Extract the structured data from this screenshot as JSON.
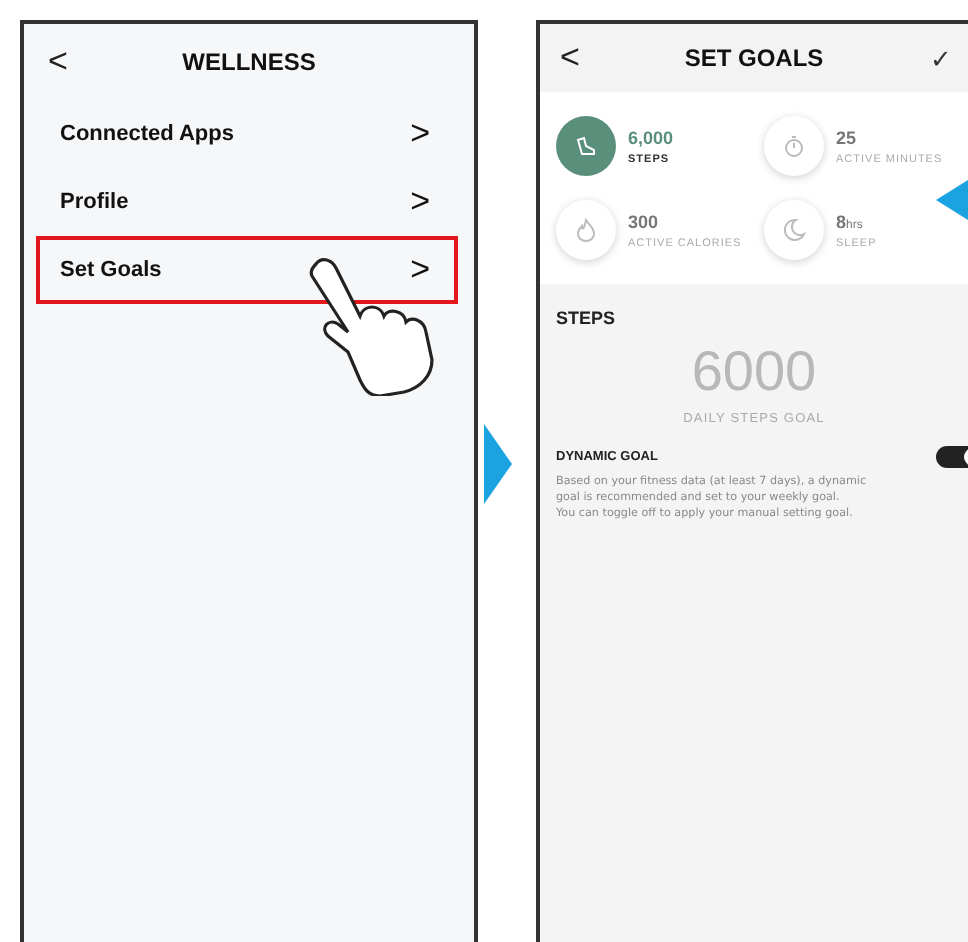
{
  "left_screen": {
    "back": "<",
    "title": "WELLNESS",
    "items": [
      {
        "label": "Connected Apps",
        "chevron": ">",
        "selected": false
      },
      {
        "label": "Profile",
        "chevron": ">",
        "selected": false
      },
      {
        "label": "Set Goals",
        "chevron": ">",
        "selected": true
      }
    ]
  },
  "right_screen": {
    "back": "<",
    "title": "SET GOALS",
    "confirm": "✓",
    "goals": [
      {
        "kind": "steps",
        "value": "6,000",
        "label": "STEPS",
        "selected": true
      },
      {
        "kind": "minutes",
        "value": "25",
        "label": "ACTIVE MINUTES",
        "selected": false
      },
      {
        "kind": "calories",
        "value": "300",
        "label": "ACTIVE CALORIES",
        "selected": false
      },
      {
        "kind": "sleep",
        "value": "8",
        "unit": "hrs",
        "label": "SLEEP",
        "selected": false
      }
    ],
    "section_title": "STEPS",
    "steps_value": "6000",
    "steps_caption": "DAILY STEPS GOAL",
    "dynamic_goal": {
      "label": "DYNAMIC GOAL",
      "on": true,
      "description": [
        "Based on your fitness data (at least 7 days), a dynamic",
        "goal is recommended and set to your weekly goal.",
        "You can toggle off to apply your manual setting goal."
      ]
    }
  }
}
